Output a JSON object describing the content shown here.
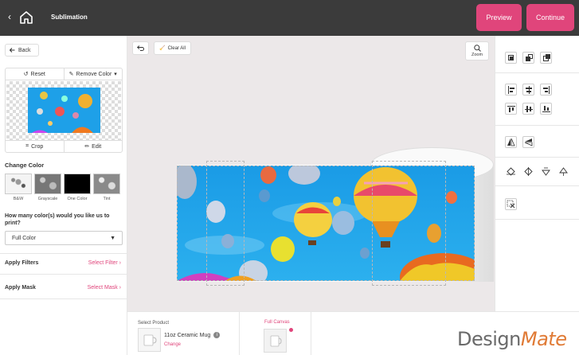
{
  "topbar": {
    "title": "Sublimation",
    "preview_label": "Preview",
    "continue_label": "Continue"
  },
  "left": {
    "back_label": "Back",
    "reset_label": "Reset",
    "remove_color_label": "Remove Color",
    "crop_label": "Crop",
    "edit_label": "Edit",
    "change_color_title": "Change Color",
    "color_options": [
      {
        "label": "B&W"
      },
      {
        "label": "Grayscale"
      },
      {
        "label": "One Color"
      },
      {
        "label": "Tint"
      }
    ],
    "colors_question": "How many color(s) would you like us to print?",
    "print_colors_value": "Full Color",
    "apply_filters_label": "Apply Filters",
    "select_filter_label": "Select Filter",
    "apply_mask_label": "Apply Mask",
    "select_mask_label": "Select Mask"
  },
  "canvas": {
    "clear_all_label": "Clear All",
    "zoom_label": "Zoom"
  },
  "bottom": {
    "select_product_label": "Select Product",
    "product_name": "11oz Ceramic Mug",
    "change_label": "Change",
    "full_canvas_label": "Full Canvas"
  },
  "brand": {
    "logo_part1": "Design",
    "logo_part2": "Mate"
  },
  "colors": {
    "accent": "#e0457b",
    "topbar": "#3b3b3b",
    "canvas_bg": "#ece8e9",
    "logo_orange": "#e07a35"
  }
}
